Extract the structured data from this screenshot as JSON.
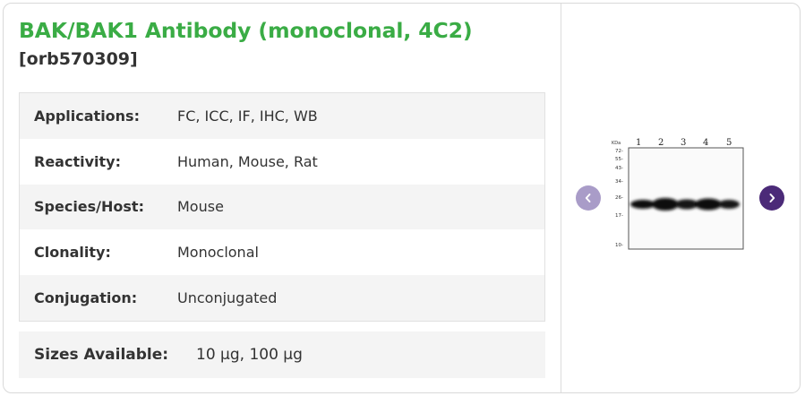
{
  "product": {
    "title": "BAK/BAK1 Antibody (monoclonal, 4C2)",
    "sku": "[orb570309]"
  },
  "specs": [
    {
      "label": "Applications:",
      "value": "FC,  ICC,  IF,  IHC,  WB"
    },
    {
      "label": "Reactivity:",
      "value": "Human, Mouse, Rat"
    },
    {
      "label": "Species/Host:",
      "value": "Mouse"
    },
    {
      "label": "Clonality:",
      "value": "Monoclonal"
    },
    {
      "label": "Conjugation:",
      "value": "Unconjugated"
    }
  ],
  "sizes": {
    "label": "Sizes Available:",
    "value": "10 µg, 100 µg"
  },
  "gallery": {
    "prev_icon": "chevron-left-icon",
    "next_icon": "chevron-right-icon",
    "prev_color": "#a99cc8",
    "next_color": "#4b2a78",
    "blot": {
      "unit": "KDa",
      "markers": [
        "72-",
        "55-",
        "43-",
        "34-",
        "26-",
        "17-",
        "10-"
      ],
      "lanes": [
        "1",
        "2",
        "3",
        "4",
        "5"
      ]
    }
  },
  "colors": {
    "title": "#3aac45",
    "row_shade": "#f4f4f4"
  }
}
